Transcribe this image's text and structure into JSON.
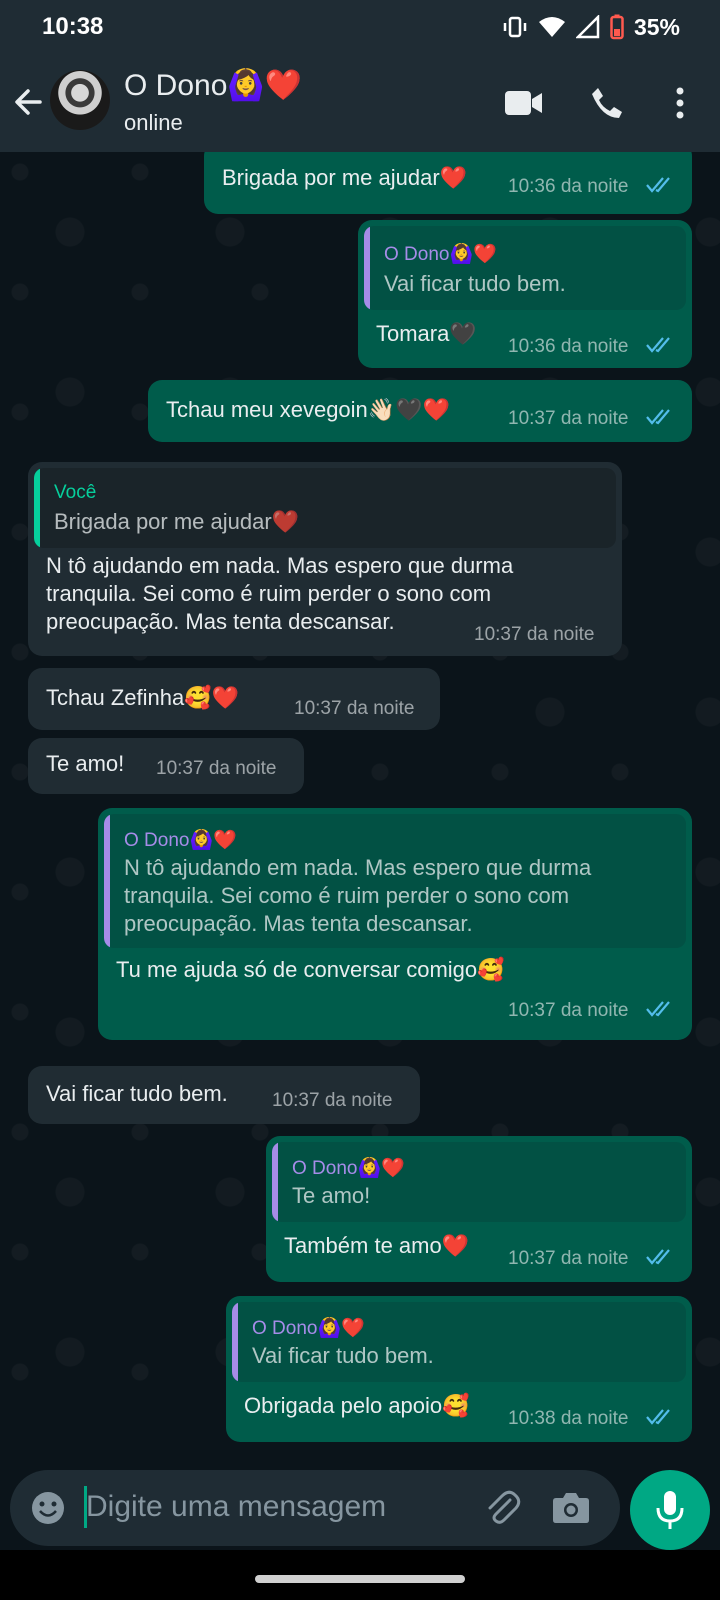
{
  "status": {
    "time": "10:38",
    "battery": "35%"
  },
  "header": {
    "name": "O Dono🙆‍♀️❤️",
    "status": "online"
  },
  "messages": [
    {
      "dir": "out",
      "text": "Brigada por me ajudar❤️",
      "time": "10:36 da noite"
    },
    {
      "dir": "out",
      "quote_author": "O Dono🙆‍♀️❤️",
      "quote_text": "Vai ficar tudo bem.",
      "text": "Tomara🖤",
      "time": "10:36 da noite"
    },
    {
      "dir": "out",
      "text": "Tchau meu xevegoin👋🏻🖤❤️",
      "time": "10:37 da noite"
    },
    {
      "dir": "in",
      "quote_author": "Você",
      "quote_text": "Brigada por me ajudar❤️",
      "text": "N tô ajudando em nada. Mas espero que durma\ntranquila. Sei como é ruim perder o sono com\npreocupação. Mas tenta descansar.",
      "time": "10:37 da noite"
    },
    {
      "dir": "in",
      "text": "Tchau Zefinha🥰❤️",
      "time": "10:37 da noite"
    },
    {
      "dir": "in",
      "text": "Te amo!",
      "time": "10:37 da noite"
    },
    {
      "dir": "out",
      "quote_author": "O Dono🙆‍♀️❤️",
      "quote_text": "N tô ajudando em nada. Mas espero que durma\ntranquila. Sei como é ruim perder o sono com\npreocupação. Mas tenta descansar.",
      "text": "Tu me ajuda só de conversar comigo🥰",
      "time": "10:37 da noite"
    },
    {
      "dir": "in",
      "text": "Vai ficar tudo bem.",
      "time": "10:37 da noite"
    },
    {
      "dir": "out",
      "quote_author": "O Dono🙆‍♀️❤️",
      "quote_text": "Te amo!",
      "text": "Também te amo❤️",
      "time": "10:37 da noite"
    },
    {
      "dir": "out",
      "quote_author": "O Dono🙆‍♀️❤️",
      "quote_text": "Vai ficar tudo bem.",
      "text": "Obrigada pelo apoio🥰",
      "time": "10:38 da noite"
    }
  ],
  "composer": {
    "placeholder": "Digite uma mensagem"
  },
  "colors": {
    "accent": "#00a884",
    "outgoing": "#005c4b",
    "incoming": "#202c33",
    "quote_mine": "#a68ce8",
    "quote_you": "#06cf9c",
    "ticks": "#53bdeb"
  }
}
